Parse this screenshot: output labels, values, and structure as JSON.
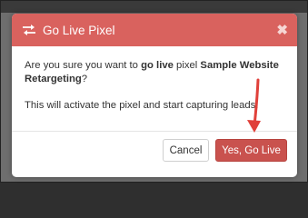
{
  "modal": {
    "title": "Go Live Pixel",
    "title_icon": "exchange-icon",
    "close_glyph": "✖",
    "body": {
      "line1_prefix": "Are you sure you want to ",
      "line1_action": "go live",
      "line1_mid": " pixel ",
      "pixel_name": "Sample Website Retargeting",
      "line1_suffix": "?",
      "line2": "This will activate the pixel and start capturing leads."
    },
    "buttons": {
      "cancel_label": "Cancel",
      "confirm_label": "Yes, Go Live"
    }
  },
  "colors": {
    "header": "#d9625e",
    "confirm_button": "#c9524e",
    "annotation_arrow": "#e0403a"
  },
  "annotation": {
    "icon": "red-arrow-icon"
  }
}
